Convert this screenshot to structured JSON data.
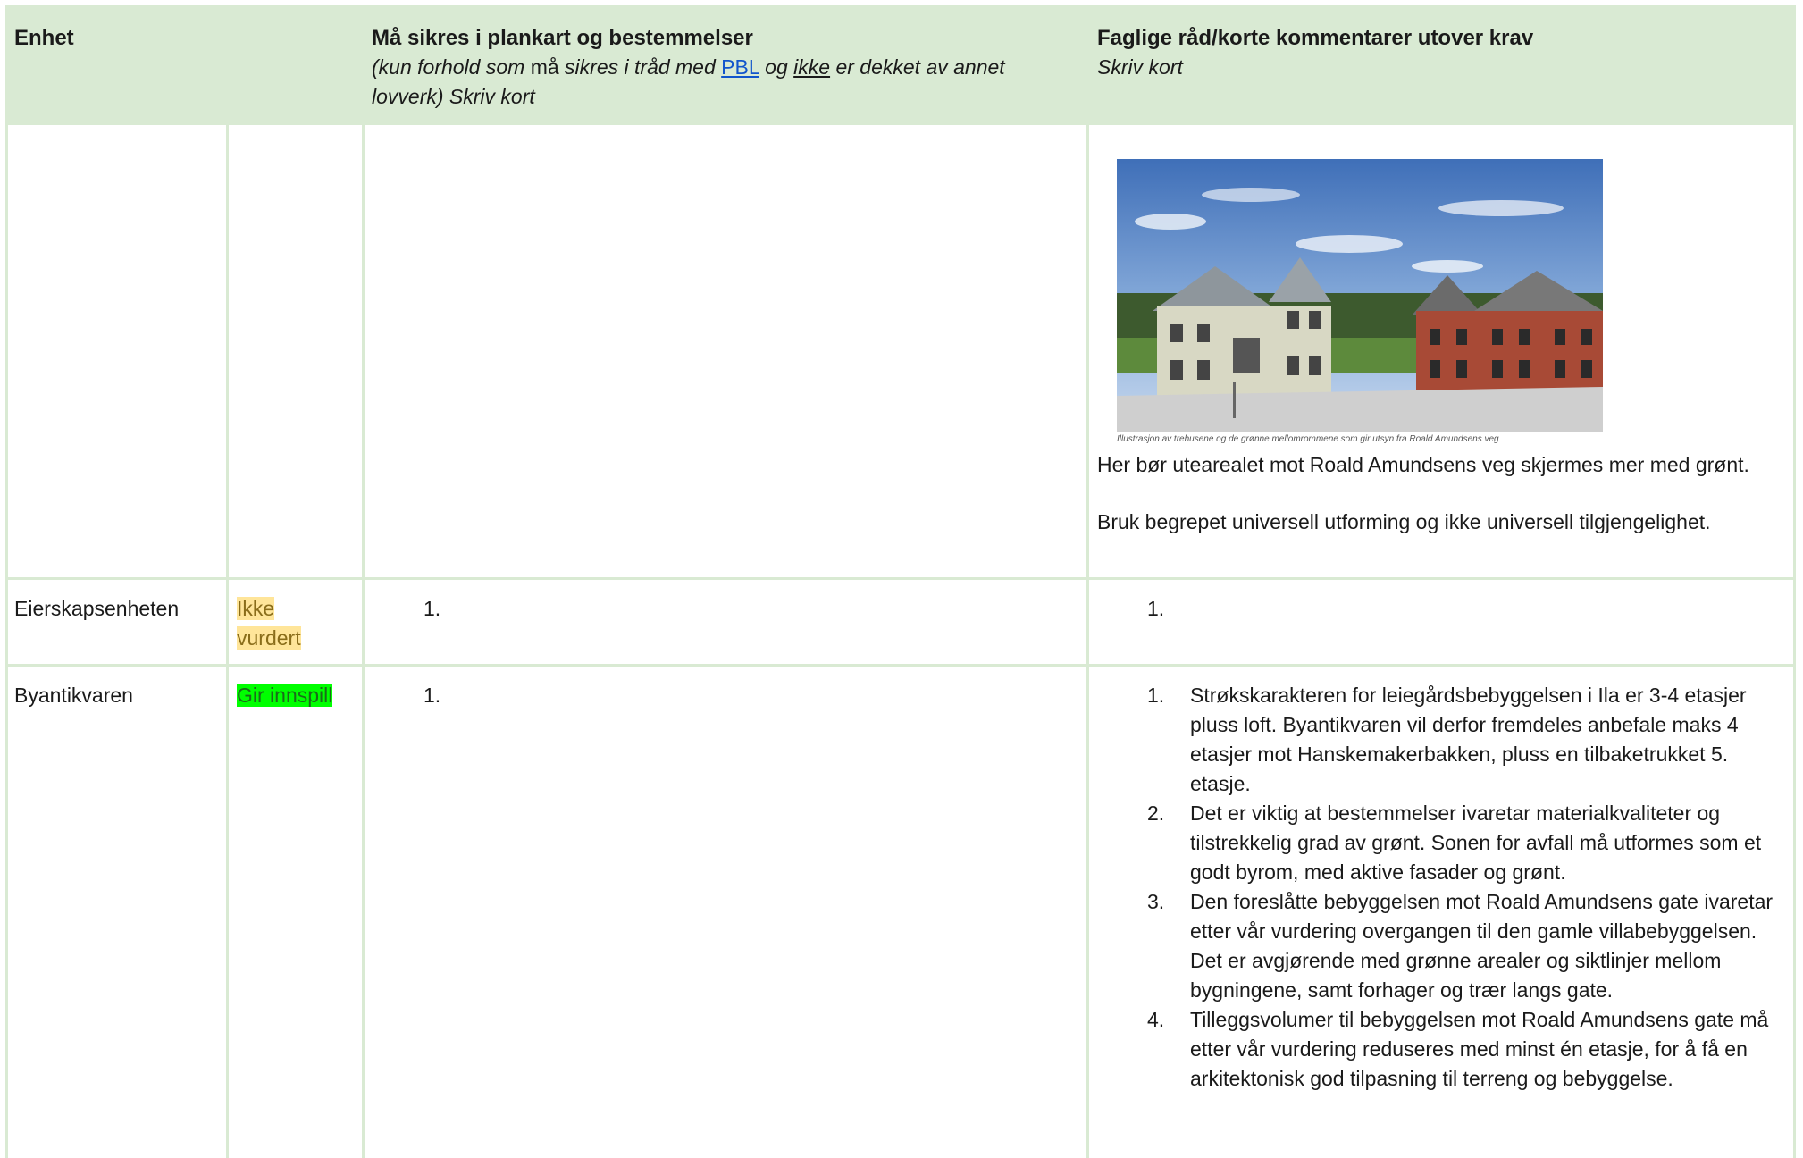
{
  "header": {
    "col1": "Enhet",
    "col3_title": "Må sikres i plankart og bestemmelser",
    "col3_sub_a": "(kun forhold som",
    "col3_sub_b": "må",
    "col3_sub_c": "sikres i tråd med",
    "col3_link": "PBL",
    "col3_sub_d": "og",
    "col3_sub_e": "ikke",
    "col3_sub_f": "er dekket av annet",
    "col3_sub_g": "lovverk) Skriv kort",
    "col4_title": "Faglige råd/korte kommentarer utover krav",
    "col4_sub": "Skriv kort"
  },
  "row0": {
    "caption": "Illustrasjon av trehusene og de grønne mellomrommene som gir utsyn fra Roald Amundsens veg",
    "para1": "Her bør utearealet mot Roald Amundsens veg skjermes mer med grønt.",
    "para2": "Bruk begrepet universell utforming og ikke universell tilgjengelighet."
  },
  "row1": {
    "unit": "Eierskapsenheten",
    "status_line1": "Ikke",
    "status_line2": "vurdert",
    "col3_num": "1.",
    "col4_num": "1."
  },
  "row2": {
    "unit": "Byantikvaren",
    "status": "Gir innspill",
    "col3_num": "1.",
    "items": [
      {
        "num": "1.",
        "text": "Strøkskarakteren for leiegårdsbebyggelsen i Ila er 3-4 etasjer pluss loft. Byantikvaren vil derfor fremdeles anbefale maks 4 etasjer mot Hanskemakerbakken, pluss en tilbaketrukket 5. etasje."
      },
      {
        "num": "2.",
        "text": "Det er viktig at bestemmelser ivaretar materialkvaliteter og tilstrekkelig grad av grønt. Sonen for avfall må utformes som et godt byrom, med aktive fasader og grønt."
      },
      {
        "num": "3.",
        "text": "Den foreslåtte bebyggelsen mot Roald Amundsens gate ivaretar etter vår vurdering overgangen til den gamle villabebyggelsen. Det er avgjørende med grønne arealer og siktlinjer mellom bygningene, samt forhager og trær langs gate."
      },
      {
        "num": "4.",
        "text": "Tilleggsvolumer til bebyggelsen mot Roald Amundsens gate må etter vår vurdering reduseres med minst én etasje, for å få en arkitektonisk god tilpasning til terreng og bebyggelse."
      }
    ]
  }
}
